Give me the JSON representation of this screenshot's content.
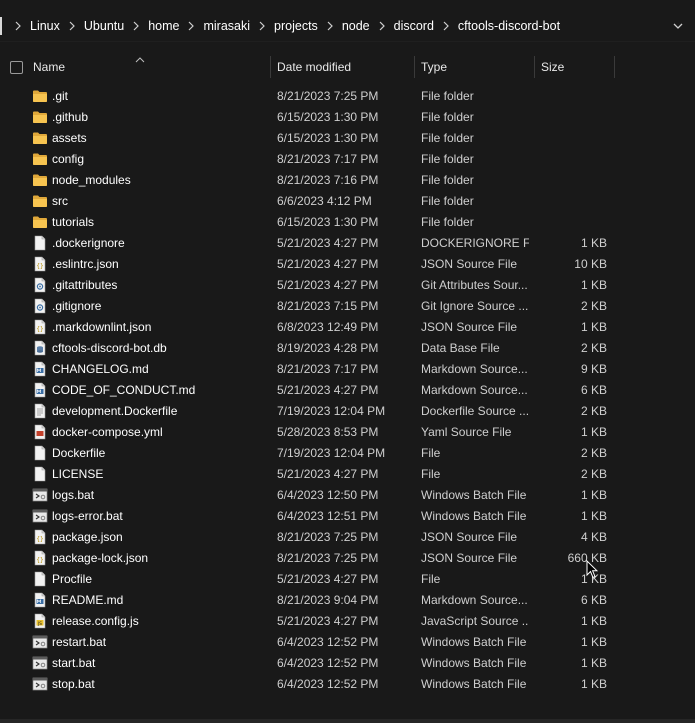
{
  "breadcrumb": [
    "Linux",
    "Ubuntu",
    "home",
    "mirasaki",
    "projects",
    "node",
    "discord",
    "cftools-discord-bot"
  ],
  "columns": {
    "name": "Name",
    "date": "Date modified",
    "type": "Type",
    "size": "Size"
  },
  "files": [
    {
      "name": ".git",
      "date": "8/21/2023 7:25 PM",
      "type": "File folder",
      "size": "",
      "icon": "folder-icon"
    },
    {
      "name": ".github",
      "date": "6/15/2023 1:30 PM",
      "type": "File folder",
      "size": "",
      "icon": "folder-icon"
    },
    {
      "name": "assets",
      "date": "6/15/2023 1:30 PM",
      "type": "File folder",
      "size": "",
      "icon": "folder-icon"
    },
    {
      "name": "config",
      "date": "8/21/2023 7:17 PM",
      "type": "File folder",
      "size": "",
      "icon": "folder-icon"
    },
    {
      "name": "node_modules",
      "date": "8/21/2023 7:16 PM",
      "type": "File folder",
      "size": "",
      "icon": "folder-icon"
    },
    {
      "name": "src",
      "date": "6/6/2023 4:12 PM",
      "type": "File folder",
      "size": "",
      "icon": "folder-icon"
    },
    {
      "name": "tutorials",
      "date": "6/15/2023 1:30 PM",
      "type": "File folder",
      "size": "",
      "icon": "folder-icon"
    },
    {
      "name": ".dockerignore",
      "date": "5/21/2023 4:27 PM",
      "type": "DOCKERIGNORE F...",
      "size": "1 KB",
      "icon": "file-icon"
    },
    {
      "name": ".eslintrc.json",
      "date": "5/21/2023 4:27 PM",
      "type": "JSON Source File",
      "size": "10 KB",
      "icon": "json-file-icon"
    },
    {
      "name": ".gitattributes",
      "date": "5/21/2023 4:27 PM",
      "type": "Git Attributes Sour...",
      "size": "1 KB",
      "icon": "settings-file-icon"
    },
    {
      "name": ".gitignore",
      "date": "8/21/2023 7:15 PM",
      "type": "Git Ignore Source ...",
      "size": "2 KB",
      "icon": "settings-file-icon"
    },
    {
      "name": ".markdownlint.json",
      "date": "6/8/2023 12:49 PM",
      "type": "JSON Source File",
      "size": "1 KB",
      "icon": "json-file-icon"
    },
    {
      "name": "cftools-discord-bot.db",
      "date": "8/19/2023 4:28 PM",
      "type": "Data Base File",
      "size": "2 KB",
      "icon": "database-file-icon"
    },
    {
      "name": "CHANGELOG.md",
      "date": "8/21/2023 7:17 PM",
      "type": "Markdown Source...",
      "size": "9 KB",
      "icon": "markdown-file-icon"
    },
    {
      "name": "CODE_OF_CONDUCT.md",
      "date": "5/21/2023 4:27 PM",
      "type": "Markdown Source...",
      "size": "6 KB",
      "icon": "markdown-file-icon"
    },
    {
      "name": "development.Dockerfile",
      "date": "7/19/2023 12:04 PM",
      "type": "Dockerfile Source ...",
      "size": "2 KB",
      "icon": "text-file-icon"
    },
    {
      "name": "docker-compose.yml",
      "date": "5/28/2023 8:53 PM",
      "type": "Yaml Source File",
      "size": "1 KB",
      "icon": "yaml-file-icon"
    },
    {
      "name": "Dockerfile",
      "date": "7/19/2023 12:04 PM",
      "type": "File",
      "size": "2 KB",
      "icon": "file-icon"
    },
    {
      "name": "LICENSE",
      "date": "5/21/2023 4:27 PM",
      "type": "File",
      "size": "2 KB",
      "icon": "file-icon"
    },
    {
      "name": "logs.bat",
      "date": "6/4/2023 12:50 PM",
      "type": "Windows Batch File",
      "size": "1 KB",
      "icon": "batch-file-icon"
    },
    {
      "name": "logs-error.bat",
      "date": "6/4/2023 12:51 PM",
      "type": "Windows Batch File",
      "size": "1 KB",
      "icon": "batch-file-icon"
    },
    {
      "name": "package.json",
      "date": "8/21/2023 7:25 PM",
      "type": "JSON Source File",
      "size": "4 KB",
      "icon": "json-file-icon"
    },
    {
      "name": "package-lock.json",
      "date": "8/21/2023 7:25 PM",
      "type": "JSON Source File",
      "size": "660 KB",
      "icon": "json-file-icon"
    },
    {
      "name": "Procfile",
      "date": "5/21/2023 4:27 PM",
      "type": "File",
      "size": "1 KB",
      "icon": "file-icon"
    },
    {
      "name": "README.md",
      "date": "8/21/2023 9:04 PM",
      "type": "Markdown Source...",
      "size": "6 KB",
      "icon": "markdown-file-icon"
    },
    {
      "name": "release.config.js",
      "date": "5/21/2023 4:27 PM",
      "type": "JavaScript Source ...",
      "size": "1 KB",
      "icon": "js-file-icon"
    },
    {
      "name": "restart.bat",
      "date": "6/4/2023 12:52 PM",
      "type": "Windows Batch File",
      "size": "1 KB",
      "icon": "batch-file-icon"
    },
    {
      "name": "start.bat",
      "date": "6/4/2023 12:52 PM",
      "type": "Windows Batch File",
      "size": "1 KB",
      "icon": "batch-file-icon"
    },
    {
      "name": "stop.bat",
      "date": "6/4/2023 12:52 PM",
      "type": "Windows Batch File",
      "size": "1 KB",
      "icon": "batch-file-icon"
    }
  ],
  "colors": {
    "background": "#191919",
    "folder": "#f4c04e",
    "text": "#ffffff",
    "muted": "#cfcfcf"
  }
}
